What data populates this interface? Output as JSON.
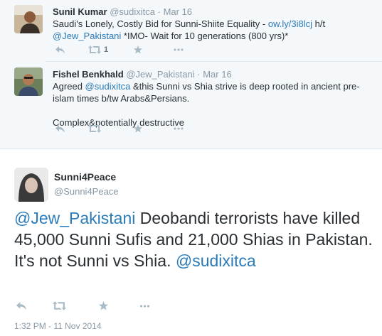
{
  "reply1": {
    "fullname": "Sunil Kumar",
    "handle": "@sudixitca",
    "dot": "·",
    "time": "Mar 16",
    "text_a": "Saudi's Lonely, Costly Bid for Sunni-Shiite Equality - ",
    "link_url": "ow.ly/3i8lcj",
    "text_b": " h/t",
    "mention": "@Jew_Pakistani",
    "text_c": " *IMO- Wait for 10 generations (800 yrs)*",
    "retweet_count": "1"
  },
  "reply2": {
    "fullname": "Fishel Benkhald",
    "handle": "@Jew_Pakistani",
    "dot": "·",
    "time": "Mar 16",
    "text_a": "Agreed ",
    "mention": "@sudixitca",
    "text_b": " &this Sunni vs Shia strive is deep rooted in ancient pre-islam times b/tw Arabs&Persians.",
    "text_c": "Complex&potentially destructive"
  },
  "main": {
    "fullname": "Sunni4Peace",
    "handle": "@Sunni4Peace",
    "mention1": "@Jew_Pakistani",
    "text": " Deobandi terrorists have killed 45,000 Sunni Sufis and 21,000 Shias in Pakistan. It's not Sunni vs Shia. ",
    "mention2": "@sudixitca",
    "datetime": "1:32 PM - 11 Nov 2014"
  },
  "icons": [
    "reply-icon",
    "retweet-icon",
    "favorite-icon",
    "more-icon"
  ],
  "colors": {
    "link": "#2b7bb9",
    "muted": "#8899a6",
    "action": "#a9bbc7",
    "reply_bg": "#f5f8fa"
  }
}
